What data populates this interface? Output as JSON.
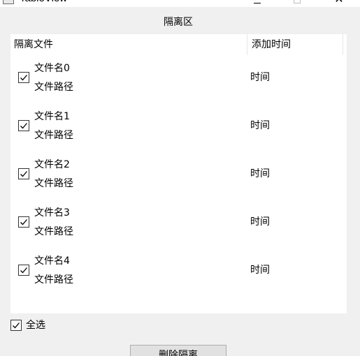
{
  "window": {
    "title": "TableView"
  },
  "section_title": "隔离区",
  "table": {
    "headers": [
      "隔离文件",
      "添加时间"
    ],
    "rows": [
      {
        "checked": true,
        "name": "文件名0",
        "path": "文件路径",
        "time": "时间"
      },
      {
        "checked": true,
        "name": "文件名1",
        "path": "文件路径",
        "time": "时间"
      },
      {
        "checked": true,
        "name": "文件名2",
        "path": "文件路径",
        "time": "时间"
      },
      {
        "checked": true,
        "name": "文件名3",
        "path": "文件路径",
        "time": "时间"
      },
      {
        "checked": true,
        "name": "文件名4",
        "path": "文件路径",
        "time": "时间"
      }
    ]
  },
  "select_all": {
    "label": "全选",
    "checked": true
  },
  "remove_button": {
    "label": "删除隔离"
  }
}
